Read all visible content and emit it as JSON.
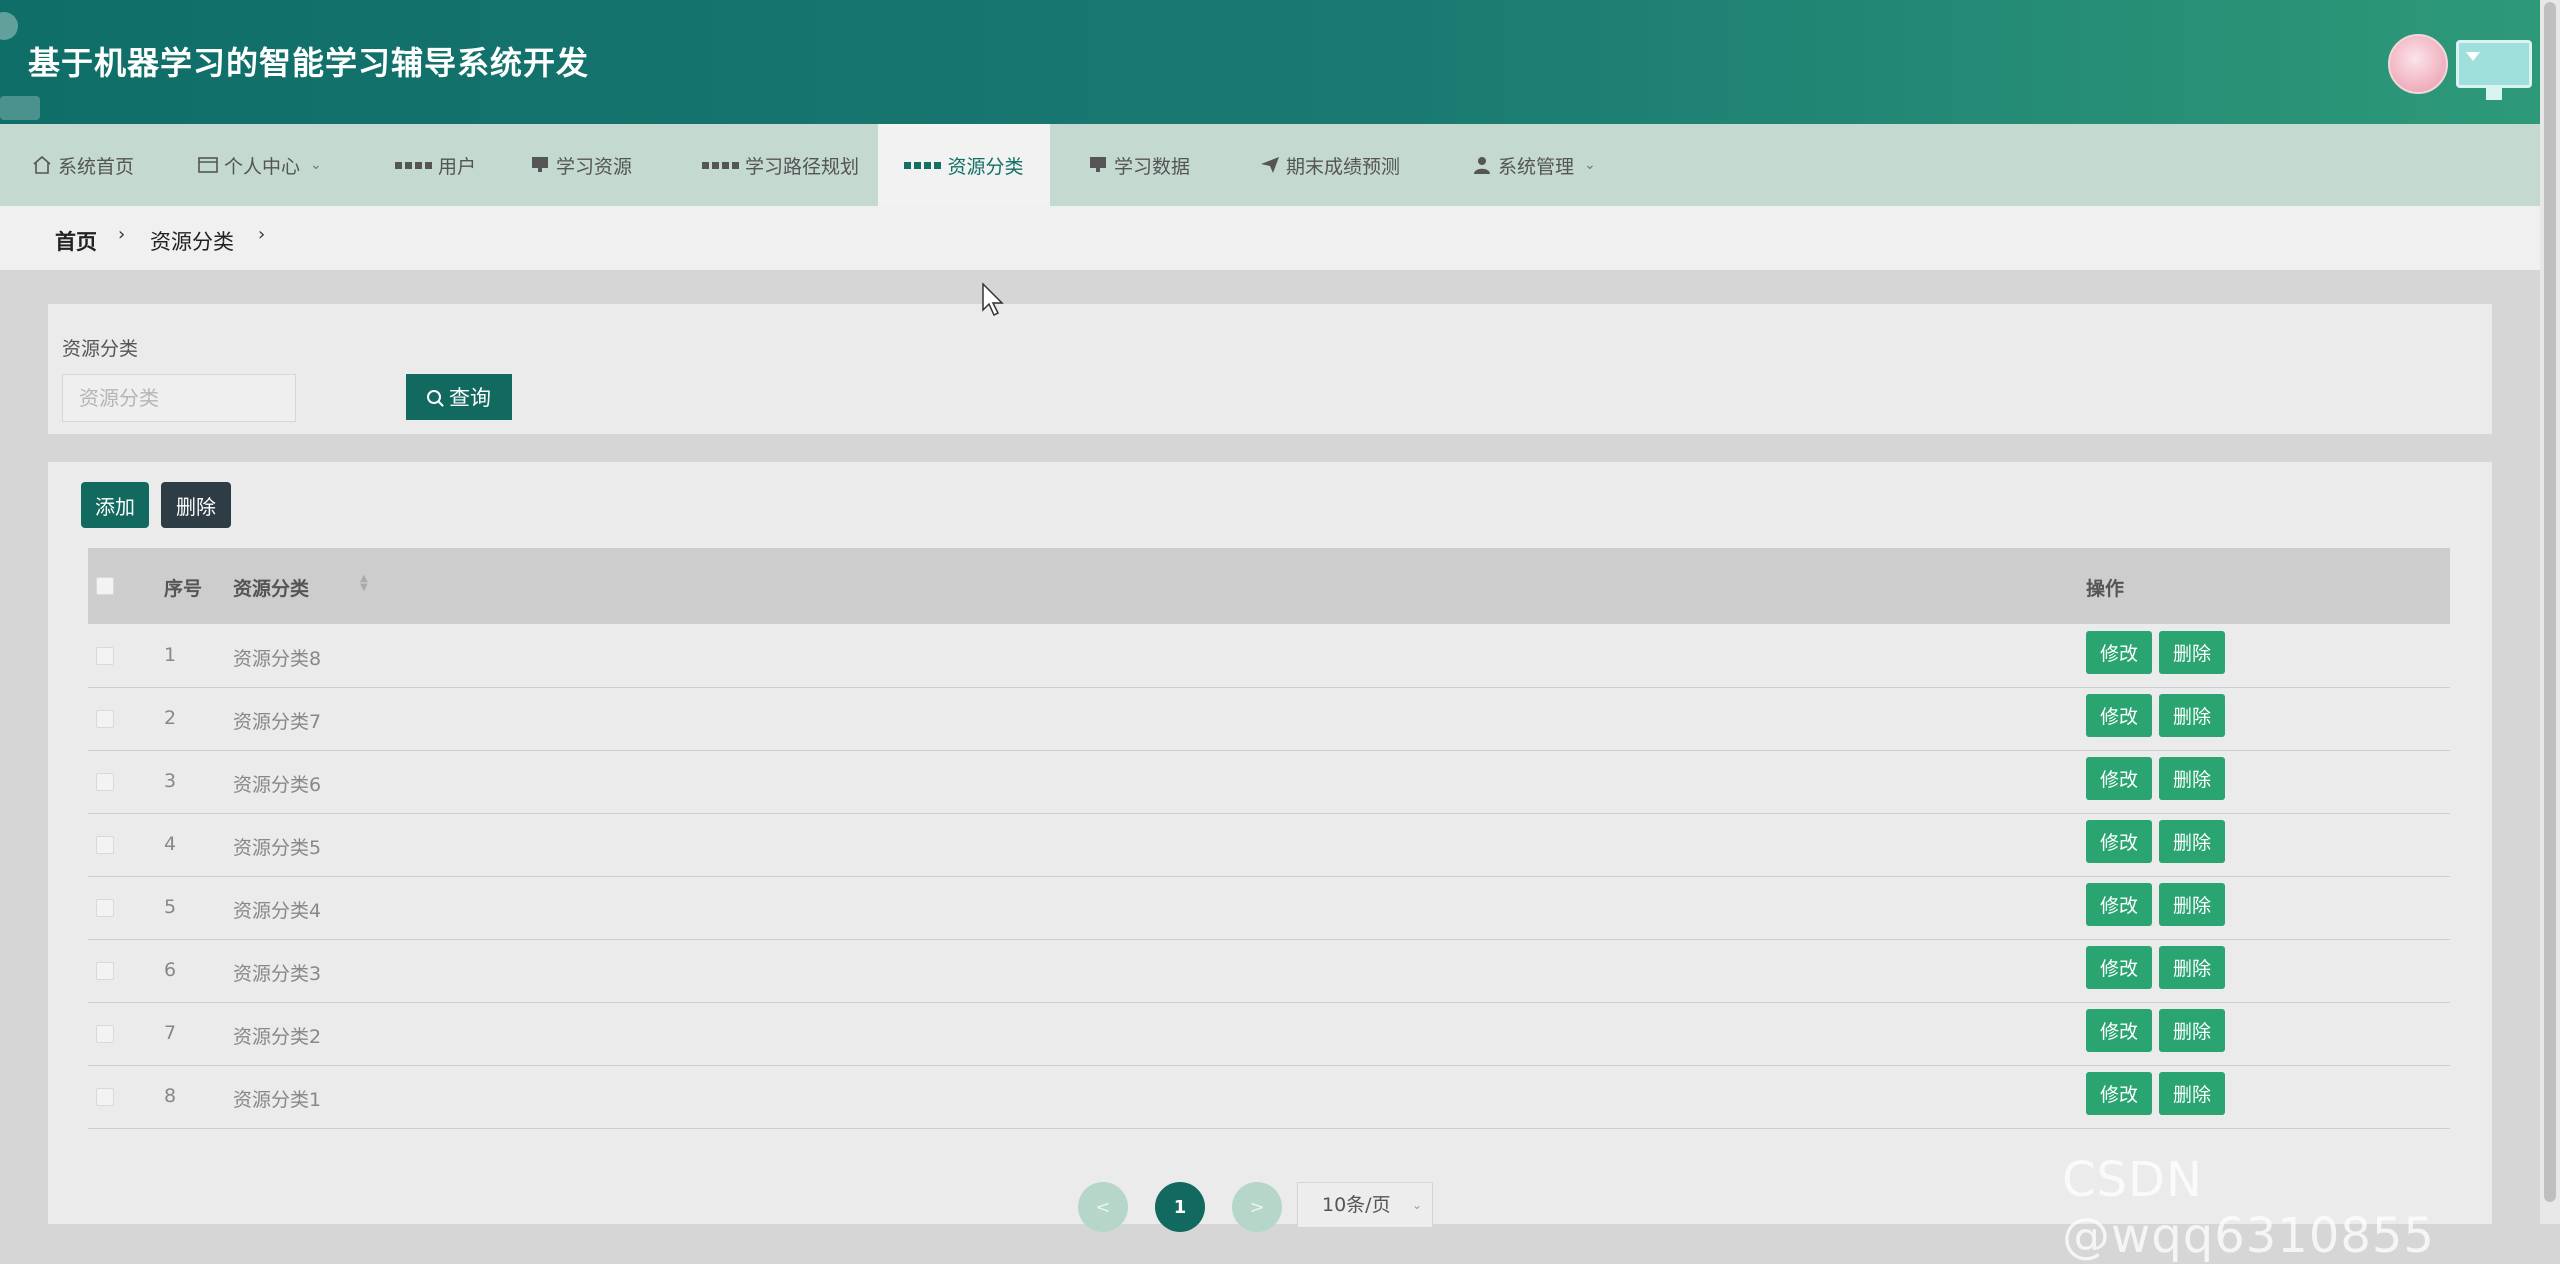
{
  "header": {
    "title": "基于机器学习的智能学习辅导系统开发"
  },
  "nav": {
    "items": [
      {
        "label": "系统首页",
        "icon": "home-icon"
      },
      {
        "label": "个人中心",
        "icon": "card-icon",
        "dropdown": true
      },
      {
        "label": "用户",
        "icon": "grid-icon"
      },
      {
        "label": "学习资源",
        "icon": "monitor-icon"
      },
      {
        "label": "学习路径规划",
        "icon": "grid-icon"
      },
      {
        "label": "资源分类",
        "icon": "grid-icon",
        "active": true
      },
      {
        "label": "学习数据",
        "icon": "monitor-icon"
      },
      {
        "label": "期末成绩预测",
        "icon": "send-icon"
      },
      {
        "label": "系统管理",
        "icon": "user-icon",
        "dropdown": true
      }
    ]
  },
  "breadcrumb": {
    "home": "首页",
    "current": "资源分类"
  },
  "search": {
    "label": "资源分类",
    "placeholder": "资源分类",
    "button": "查询"
  },
  "toolbar": {
    "add": "添加",
    "delete": "删除"
  },
  "table": {
    "headers": {
      "index": "序号",
      "category": "资源分类",
      "actions": "操作"
    },
    "rows": [
      {
        "index": "1",
        "category": "资源分类8"
      },
      {
        "index": "2",
        "category": "资源分类7"
      },
      {
        "index": "3",
        "category": "资源分类6"
      },
      {
        "index": "4",
        "category": "资源分类5"
      },
      {
        "index": "5",
        "category": "资源分类4"
      },
      {
        "index": "6",
        "category": "资源分类3"
      },
      {
        "index": "7",
        "category": "资源分类2"
      },
      {
        "index": "8",
        "category": "资源分类1"
      }
    ],
    "row_actions": {
      "edit": "修改",
      "delete": "删除"
    }
  },
  "pagination": {
    "prev": "<",
    "current": "1",
    "next": ">",
    "page_size": "10条/页"
  },
  "watermark": "CSDN @wqq6310855",
  "colors": {
    "primary": "#12695f",
    "accent": "#2aa572",
    "nav_bg": "#c4d9cf"
  }
}
